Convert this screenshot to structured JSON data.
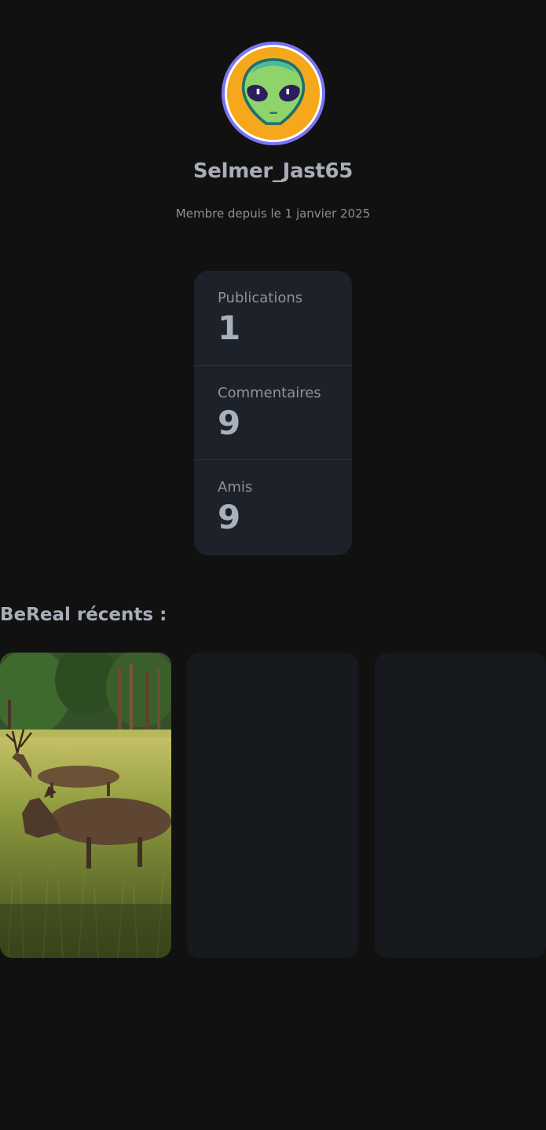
{
  "profile": {
    "username": "Selmer_Jast65",
    "member_since": "Membre depuis le 1 janvier 2025",
    "avatar_icon": "alien-icon",
    "avatar_border_color": "#7b73f0",
    "avatar_bg_color": "#f5a81c"
  },
  "stats": [
    {
      "label": "Publications",
      "value": "1"
    },
    {
      "label": "Commentaires",
      "value": "9"
    },
    {
      "label": "Amis",
      "value": "9"
    }
  ],
  "recent": {
    "title": "BeReal récents :",
    "tiles": [
      {
        "kind": "photo",
        "subject": "deer in meadow"
      },
      {
        "kind": "empty"
      },
      {
        "kind": "empty"
      }
    ]
  },
  "colors": {
    "background": "#111111",
    "card": "#1c212a",
    "tile_placeholder": "#16191e"
  }
}
